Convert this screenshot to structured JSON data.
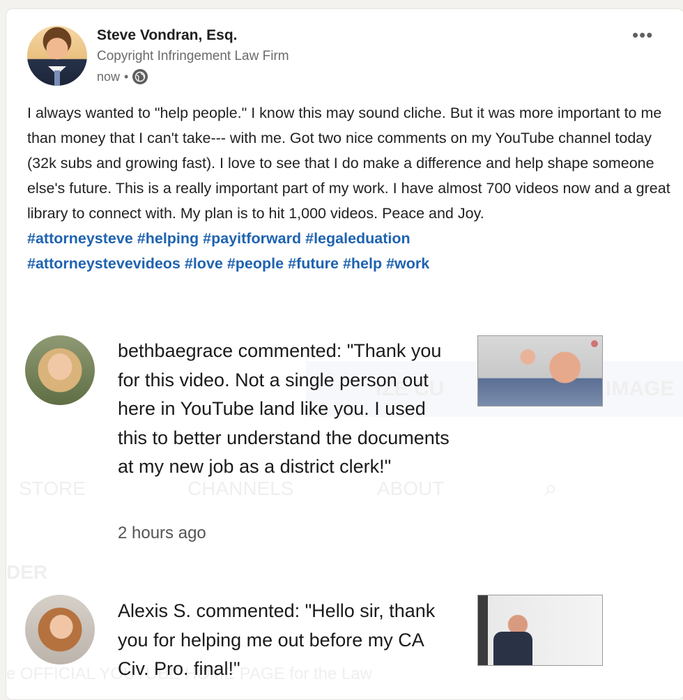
{
  "post": {
    "author_name": "Steve Vondran, Esq.",
    "author_headline": "Copyright Infringement Law Firm",
    "timestamp": "now",
    "separator": "•",
    "visibility_icon": "globe-icon",
    "more_icon": "more-options-icon",
    "more_label": "•••",
    "body": "I always wanted to \"help people.\" I know this may sound cliche. But it was more important to me than money that I can't take--- with me. Got two nice comments on my YouTube channel today (32k subs and growing fast). I love to see that I do make a difference and help shape someone else's future. This is a really important part of my work. I have almost 700 videos now and a great library to connect with. My plan is to hit 1,000 videos. Peace and Joy.",
    "hashtags": [
      "#attorneysteve",
      "#helping",
      "#payitforward",
      "#legaleduation",
      "#attorneystevevideos",
      "#love",
      "#people",
      "#future",
      "#help",
      "#work"
    ]
  },
  "comments": [
    {
      "text": "bethbaegrace commented: \"Thank you for this video. Not a single person out here in YouTube land like you. I used this to better understand the documents at my new job as a district clerk!\"",
      "time": "2 hours ago"
    },
    {
      "text": "Alexis S. commented: \"Hello sir, thank you for helping me out before my CA Civ. Pro. final!\""
    }
  ],
  "background_text": {
    "store": "STORE",
    "channels": "CHANNELS",
    "about": "ABOUT",
    "ize": "IZE CU",
    "image": "IMAGE",
    "order": "DER",
    "official": "e OFFICIAL YOUTUBE HOME PAGE for the Law"
  },
  "colors": {
    "hashtag": "#1f63b0",
    "background": "#f3f2ef",
    "card": "#ffffff"
  }
}
